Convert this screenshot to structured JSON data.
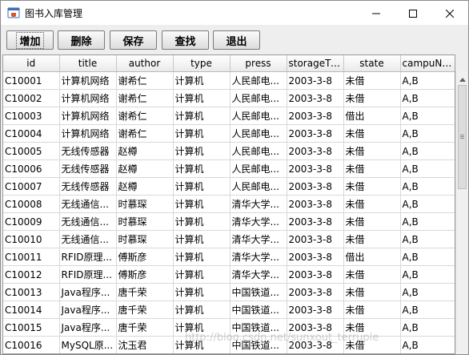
{
  "window": {
    "title": "图书入库管理",
    "icon": "java-cup-icon",
    "controls": [
      "minimize-icon",
      "maximize-icon",
      "close-icon"
    ]
  },
  "toolbar": {
    "add_label": "增加",
    "delete_label": "删除",
    "save_label": "保存",
    "search_label": "查找",
    "exit_label": "退出"
  },
  "table": {
    "columns": [
      "id",
      "title",
      "author",
      "type",
      "press",
      "storageTi...",
      "state",
      "campuNa..."
    ],
    "rows": [
      [
        "C10001",
        "计算机网络",
        "谢希仁",
        "计算机",
        "人民邮电...",
        "2003-3-8",
        "未借",
        "A,B"
      ],
      [
        "C10002",
        "计算机网络",
        "谢希仁",
        "计算机",
        "人民邮电...",
        "2003-3-8",
        "未借",
        "A,B"
      ],
      [
        "C10003",
        "计算机网络",
        "谢希仁",
        "计算机",
        "人民邮电...",
        "2003-3-8",
        "借出",
        "A,B"
      ],
      [
        "C10004",
        "计算机网络",
        "谢希仁",
        "计算机",
        "人民邮电...",
        "2003-3-8",
        "未借",
        "A,B"
      ],
      [
        "C10005",
        "无线传感器",
        "赵樽",
        "计算机",
        "人民邮电...",
        "2003-3-8",
        "未借",
        "A,B"
      ],
      [
        "C10006",
        "无线传感器",
        "赵樽",
        "计算机",
        "人民邮电...",
        "2003-3-8",
        "未借",
        "A,B"
      ],
      [
        "C10007",
        "无线传感器",
        "赵樽",
        "计算机",
        "人民邮电...",
        "2003-3-8",
        "未借",
        "A,B"
      ],
      [
        "C10008",
        "无线通信...",
        "时慕琛",
        "计算机",
        "清华大学...",
        "2003-3-8",
        "未借",
        "A,B"
      ],
      [
        "C10009",
        "无线通信...",
        "时慕琛",
        "计算机",
        "清华大学...",
        "2003-3-8",
        "未借",
        "A,B"
      ],
      [
        "C10010",
        "无线通信...",
        "时慕琛",
        "计算机",
        "清华大学...",
        "2003-3-8",
        "未借",
        "A,B"
      ],
      [
        "C10011",
        "RFID原理...",
        "傅斯彦",
        "计算机",
        "清华大学...",
        "2003-3-8",
        "借出",
        "A,B"
      ],
      [
        "C10012",
        "RFID原理...",
        "傅斯彦",
        "计算机",
        "清华大学...",
        "2003-3-8",
        "未借",
        "A,B"
      ],
      [
        "C10013",
        "Java程序...",
        "唐千荣",
        "计算机",
        "中国铁道...",
        "2003-3-8",
        "未借",
        "A,B"
      ],
      [
        "C10014",
        "Java程序...",
        "唐千荣",
        "计算机",
        "中国铁道...",
        "2003-3-8",
        "未借",
        "A,B"
      ],
      [
        "C10015",
        "Java程序...",
        "唐千荣",
        "计算机",
        "中国铁道...",
        "2003-3-8",
        "未借",
        "A,B"
      ],
      [
        "C10016",
        "MySQL原...",
        "沈玉君",
        "计算机",
        "中国铁道...",
        "2003-3-8",
        "未借",
        "A,B"
      ]
    ]
  },
  "watermark": "http://blog.csdn.net/sunxout_terruple"
}
